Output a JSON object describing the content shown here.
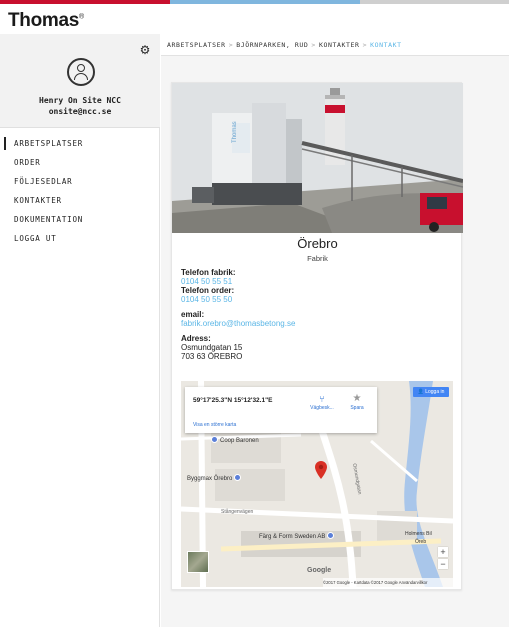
{
  "brand": {
    "logo": "Thomas",
    "logo_mark": "®"
  },
  "user": {
    "name": "Henry On Site NCC",
    "email": "onsite@ncc.se"
  },
  "nav": {
    "items": [
      {
        "label": "ARBETSPLATSER"
      },
      {
        "label": "ORDER"
      },
      {
        "label": "FÖLJESEDLAR"
      },
      {
        "label": "KONTAKTER"
      },
      {
        "label": "DOKUMENTATION"
      },
      {
        "label": "LOGGA UT"
      }
    ]
  },
  "breadcrumb": [
    "ARBETSPLATSER",
    "BJÖRNPARKEN, RUD",
    "KONTAKTER",
    "KONTAKT"
  ],
  "breadcrumb_sep": ">",
  "contact": {
    "title": "Örebro",
    "subtitle": "Fabrik",
    "phone_factory_label": "Telefon fabrik:",
    "phone_factory": "0104 50 55 51",
    "phone_order_label": "Telefon order:",
    "phone_order": "0104 50 55 50",
    "email_label": "email:",
    "email": "fabrik.orebro@thomasbetong.se",
    "address_label": "Adress:",
    "address_line1": "Osmundgatan 15",
    "address_line2": "703 63 ÖREBRO"
  },
  "map": {
    "coords": "59°17'25.3\"N 15°12'32.1\"E",
    "directions_label": "Vägbesk...",
    "save_label": "Spara",
    "bigger_map": "Visa en större karta",
    "login": "Logga in",
    "poi_coop": "Coop Baronen",
    "poi_byggmax": "Byggmax Örebro",
    "street_stangen": "Stångenvägen",
    "street_osmund": "Osmundgatan",
    "poi_farg": "Färg & Form Sweden AB",
    "poi_holmens": "Holmens Bil",
    "poi_orebro": "Öreb",
    "google": "Google",
    "copyright": "©2017 Google - Kartdata ©2017 Google  Användarvillkor",
    "zoom_in": "+",
    "zoom_out": "−"
  },
  "colors": {
    "accent": "#5bb6e6",
    "brand_red": "#c8102e",
    "pin": "#d93025"
  }
}
